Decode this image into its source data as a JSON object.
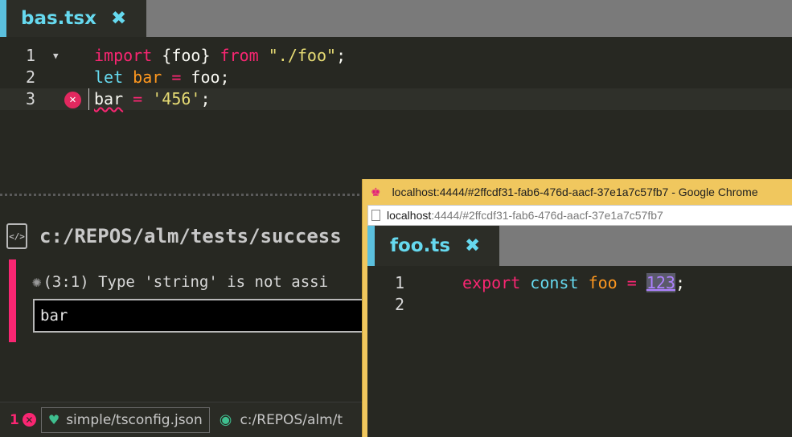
{
  "editor": {
    "tab": {
      "title": "bas.tsx",
      "close_icon": "close-icon"
    },
    "lines": [
      {
        "number": "1",
        "tokens": [
          "import",
          " {foo} ",
          "from",
          " ",
          "\"./foo\"",
          ";"
        ]
      },
      {
        "number": "2",
        "tokens": [
          "let",
          " ",
          "bar",
          " ",
          "=",
          " foo;"
        ]
      },
      {
        "number": "3",
        "tokens": [
          "bar",
          " ",
          "=",
          " ",
          "'456'",
          ";"
        ]
      }
    ]
  },
  "error_panel": {
    "file_path": "c:/REPOS/alm/tests/success",
    "message": "(3:1) Type 'string' is not assi",
    "snippet": "bar"
  },
  "status_bar": {
    "error_count": "1",
    "tsconfig": "simple/tsconfig.json",
    "path": "c:/REPOS/alm/t"
  },
  "chrome_window": {
    "title": "localhost:4444/#2ffcdf31-fab6-476d-aacf-37e1a7c57fb7 - Google Chrome",
    "address_host": "localhost",
    "address_rest": ":4444/#2ffcdf31-fab6-476d-aacf-37e1a7c57fb7",
    "tab": {
      "title": "foo.ts"
    },
    "lines": [
      {
        "number": "1",
        "tokens": [
          "export",
          " ",
          "const",
          " ",
          "foo",
          " ",
          "=",
          " ",
          "123",
          ";"
        ]
      },
      {
        "number": "2",
        "tokens": []
      }
    ]
  },
  "colors": {
    "background": "#272822",
    "accent": "#66d9ef",
    "keyword": "#f92672",
    "string": "#e6db74",
    "variable": "#fd971f",
    "number": "#ae81ff",
    "chrome_frame": "#f0c75e"
  }
}
